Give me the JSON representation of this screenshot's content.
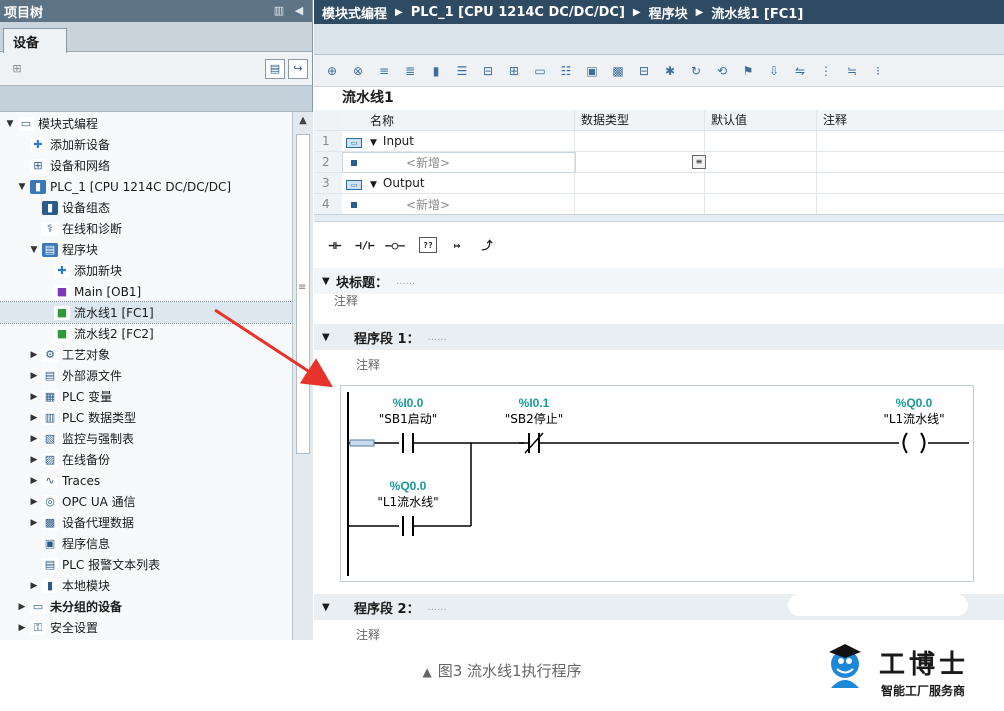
{
  "left_panel": {
    "title": "项目树",
    "device_tab": "设备",
    "tree": [
      {
        "label": "模块式编程",
        "icon": "project-icon",
        "arrow": "▼",
        "indent": 0
      },
      {
        "label": "添加新设备",
        "icon": "add-device-icon",
        "arrow": "",
        "indent": 1
      },
      {
        "label": "设备和网络",
        "icon": "network-icon",
        "arrow": "",
        "indent": 1
      },
      {
        "label": "PLC_1 [CPU 1214C DC/DC/DC]",
        "icon": "plc-icon",
        "arrow": "▼",
        "indent": 1
      },
      {
        "label": "设备组态",
        "icon": "device-config-icon",
        "arrow": "",
        "indent": 2
      },
      {
        "label": "在线和诊断",
        "icon": "diagnostics-icon",
        "arrow": "",
        "indent": 2
      },
      {
        "label": "程序块",
        "icon": "program-blocks-icon",
        "arrow": "▼",
        "indent": 2
      },
      {
        "label": "添加新块",
        "icon": "add-block-icon",
        "arrow": "",
        "indent": 3
      },
      {
        "label": "Main [OB1]",
        "icon": "ob-icon",
        "arrow": "",
        "indent": 3
      },
      {
        "label": "流水线1 [FC1]",
        "icon": "fc-icon",
        "arrow": "",
        "indent": 3,
        "selected": true
      },
      {
        "label": "流水线2 [FC2]",
        "icon": "fc-icon",
        "arrow": "",
        "indent": 3
      },
      {
        "label": "工艺对象",
        "icon": "technology-objects-icon",
        "arrow": "▶",
        "indent": 2
      },
      {
        "label": "外部源文件",
        "icon": "external-source-icon",
        "arrow": "▶",
        "indent": 2
      },
      {
        "label": "PLC 变量",
        "icon": "plc-tags-icon",
        "arrow": "▶",
        "indent": 2
      },
      {
        "label": "PLC 数据类型",
        "icon": "plc-datatypes-icon",
        "arrow": "▶",
        "indent": 2
      },
      {
        "label": "监控与强制表",
        "icon": "watch-table-icon",
        "arrow": "▶",
        "indent": 2
      },
      {
        "label": "在线备份",
        "icon": "online-backup-icon",
        "arrow": "▶",
        "indent": 2
      },
      {
        "label": "Traces",
        "icon": "traces-icon",
        "arrow": "▶",
        "indent": 2
      },
      {
        "label": "OPC UA 通信",
        "icon": "opc-ua-icon",
        "arrow": "▶",
        "indent": 2
      },
      {
        "label": "设备代理数据",
        "icon": "device-proxy-icon",
        "arrow": "▶",
        "indent": 2
      },
      {
        "label": "程序信息",
        "icon": "program-info-icon",
        "arrow": "",
        "indent": 2
      },
      {
        "label": "PLC 报警文本列表",
        "icon": "alarm-text-icon",
        "arrow": "",
        "indent": 2
      },
      {
        "label": "本地模块",
        "icon": "local-modules-icon",
        "arrow": "▶",
        "indent": 2
      },
      {
        "label": "未分组的设备",
        "icon": "ungrouped-devices-icon",
        "arrow": "▶",
        "indent": 1,
        "bold": true
      },
      {
        "label": "安全设置",
        "icon": "security-icon",
        "arrow": "▶",
        "indent": 1
      }
    ]
  },
  "editor": {
    "breadcrumb": [
      "模块式编程",
      "PLC_1 [CPU 1214C DC/DC/DC]",
      "程序块",
      "流水线1 [FC1]"
    ],
    "block_title": "流水线1",
    "interface": {
      "headers": {
        "name": "名称",
        "type": "数据类型",
        "default": "默认值",
        "comment": "注释"
      },
      "rows": [
        {
          "num": "1",
          "name": "Input",
          "kind": "section"
        },
        {
          "num": "2",
          "name": "<新增>",
          "kind": "new"
        },
        {
          "num": "3",
          "name": "Output",
          "kind": "section"
        },
        {
          "num": "4",
          "name": "<新增>",
          "kind": "new"
        }
      ]
    },
    "block_heading_label": "块标题：",
    "block_heading_dots": "......",
    "block_comment": "注释",
    "network1": {
      "title": "程序段 1：",
      "dots": "......",
      "comment": "注释",
      "contact1_addr": "%I0.0",
      "contact1_name": "\"SB1启动\"",
      "contact2_addr": "%I0.1",
      "contact2_name": "\"SB2停止\"",
      "coil_addr": "%Q0.0",
      "coil_name": "\"L1流水线\"",
      "branch_addr": "%Q0.0",
      "branch_name": "\"L1流水线\""
    },
    "network2": {
      "title": "程序段 2：",
      "dots": "......",
      "comment": "注释"
    }
  },
  "caption": "图3 流水线1执行程序",
  "logo": {
    "name": "工博士",
    "tagline": "智能工厂服务商"
  },
  "colors": {
    "breadcrumb_bg": "#2f4a63",
    "tree_title_bg": "#5d7386",
    "address_teal": "#1a9a9a",
    "annotation_arrow": "#e8332a",
    "logo_blue": "#1e88d8"
  }
}
